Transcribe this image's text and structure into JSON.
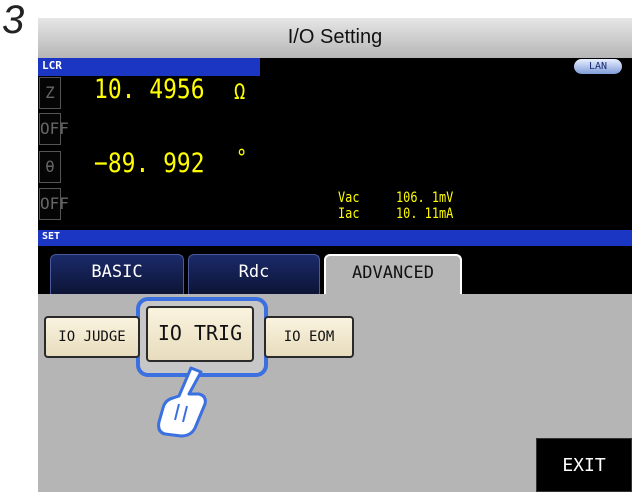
{
  "step": "3",
  "title": "I/O Setting",
  "status": {
    "lcr_label": "LCR",
    "lan_badge": "LAN"
  },
  "measurement": {
    "param1": {
      "name": "Z",
      "value": "10. 4956",
      "unit": "Ω",
      "state": "OFF"
    },
    "param2": {
      "name": "θ",
      "value": "−89. 992",
      "unit": "°",
      "state": "OFF"
    },
    "vac": {
      "label": "Vac",
      "value": "106. 1mV"
    },
    "iac": {
      "label": "Iac",
      "value": "10. 11mA"
    }
  },
  "set_label": "SET",
  "tabs": [
    {
      "label": "BASIC",
      "active": false
    },
    {
      "label": "Rdc",
      "active": false
    },
    {
      "label": "ADVANCED",
      "active": true
    }
  ],
  "io_buttons": {
    "judge": "IO JUDGE",
    "trig": "IO TRIG",
    "eom": "IO EOM"
  },
  "exit_label": "EXIT",
  "colors": {
    "accent_blue": "#1c36c4",
    "measure_text": "#ffff00",
    "highlight": "#3b70e0"
  },
  "icons": {
    "pointer": "hand-pointer-icon"
  }
}
